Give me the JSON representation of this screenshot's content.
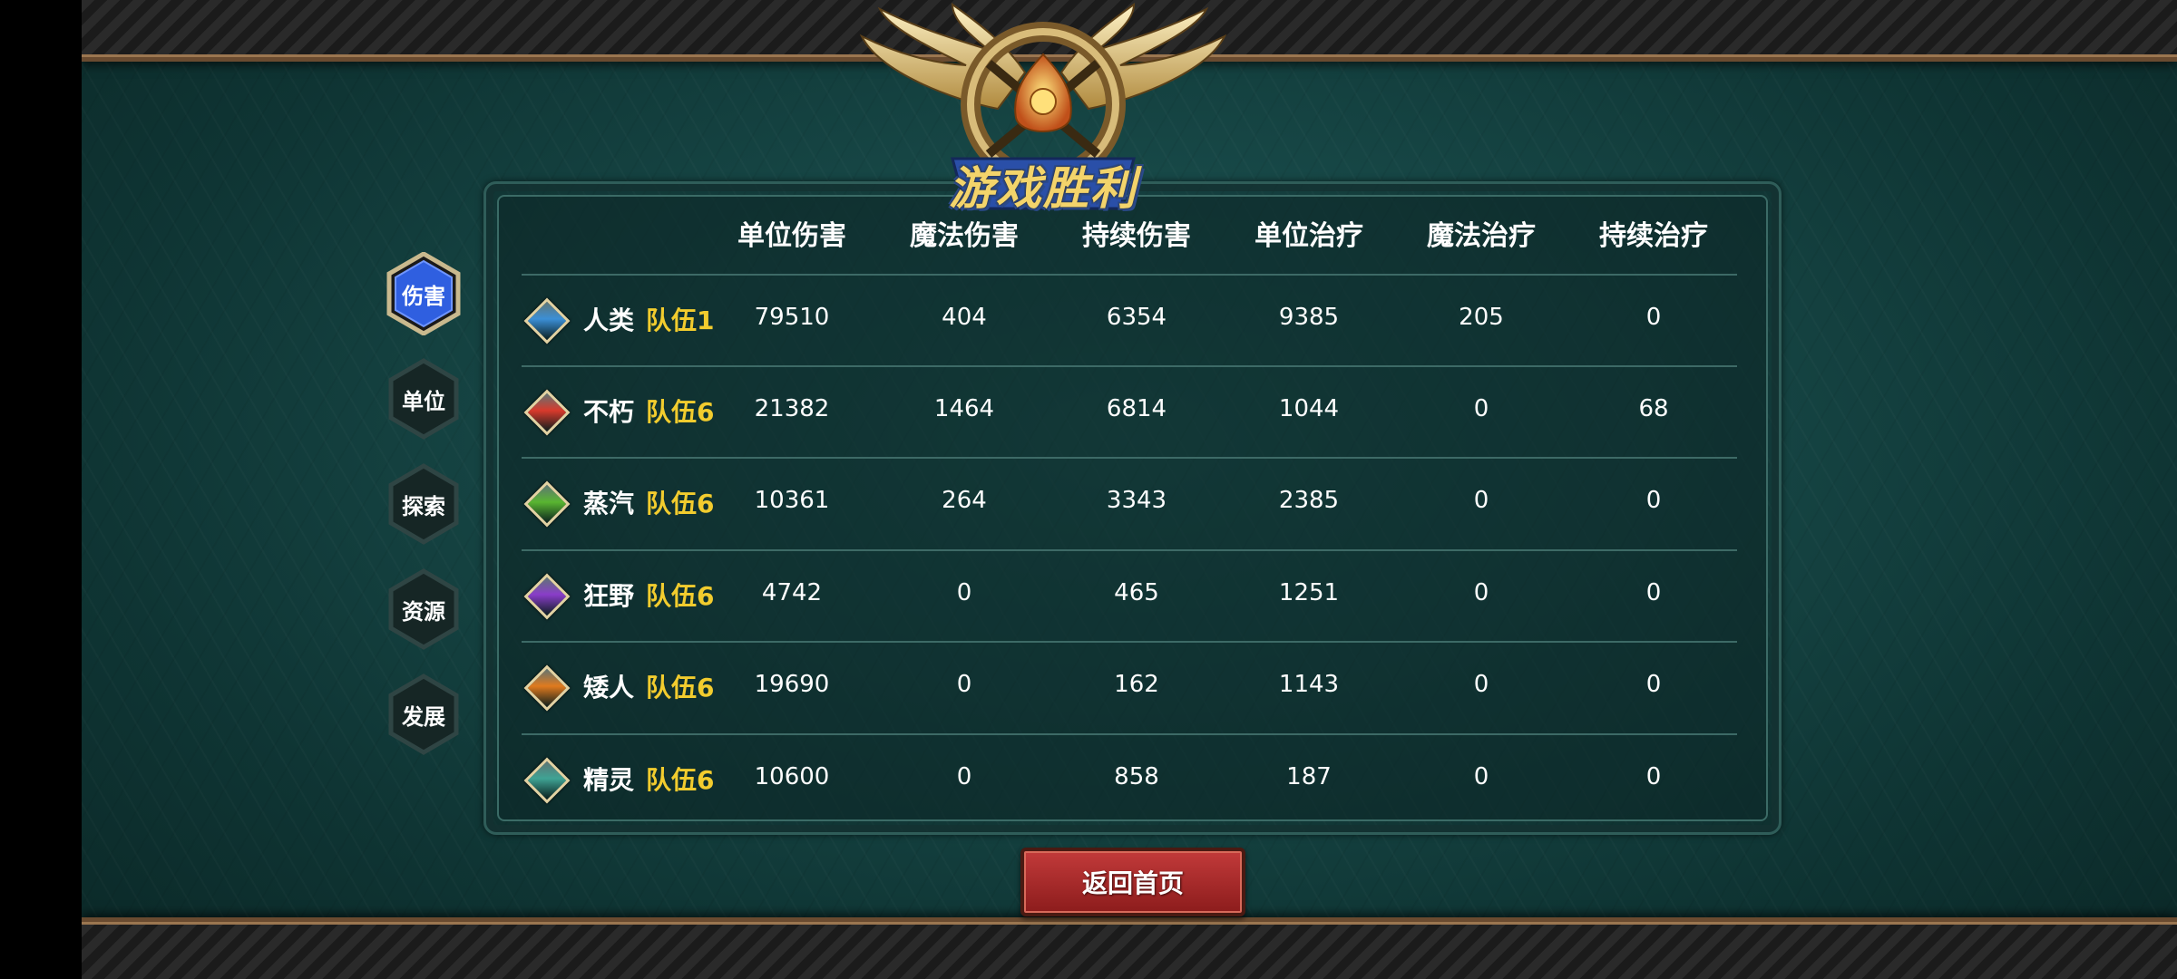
{
  "title": "游戏胜利",
  "colors": {
    "team": "#f2cc2e",
    "active_tab": "#2f5fe0"
  },
  "tabs": [
    {
      "label": "伤害",
      "active": true
    },
    {
      "label": "单位",
      "active": false
    },
    {
      "label": "探索",
      "active": false
    },
    {
      "label": "资源",
      "active": false
    },
    {
      "label": "发展",
      "active": false
    }
  ],
  "columns": [
    "单位伤害",
    "魔法伤害",
    "持续伤害",
    "单位治疗",
    "魔法治疗",
    "持续治疗"
  ],
  "rows": [
    {
      "race": "人类",
      "team": "队伍1",
      "gem": "blue",
      "gem_color": "#3b8fd6",
      "values": [
        "79510",
        "404",
        "6354",
        "9385",
        "205",
        "0"
      ]
    },
    {
      "race": "不朽",
      "team": "队伍6",
      "gem": "red",
      "gem_color": "#d83a2c",
      "values": [
        "21382",
        "1464",
        "6814",
        "1044",
        "0",
        "68"
      ]
    },
    {
      "race": "蒸汽",
      "team": "队伍6",
      "gem": "green",
      "gem_color": "#59b531",
      "values": [
        "10361",
        "264",
        "3343",
        "2385",
        "0",
        "0"
      ]
    },
    {
      "race": "狂野",
      "team": "队伍6",
      "gem": "purple",
      "gem_color": "#8a3dc9",
      "values": [
        "4742",
        "0",
        "465",
        "1251",
        "0",
        "0"
      ]
    },
    {
      "race": "矮人",
      "team": "队伍6",
      "gem": "orange",
      "gem_color": "#e07a1e",
      "values": [
        "19690",
        "0",
        "162",
        "1143",
        "0",
        "0"
      ]
    },
    {
      "race": "精灵",
      "team": "队伍6",
      "gem": "teal",
      "gem_color": "#3fa394",
      "values": [
        "10600",
        "0",
        "858",
        "187",
        "0",
        "0"
      ]
    }
  ],
  "return_button": "返回首页"
}
